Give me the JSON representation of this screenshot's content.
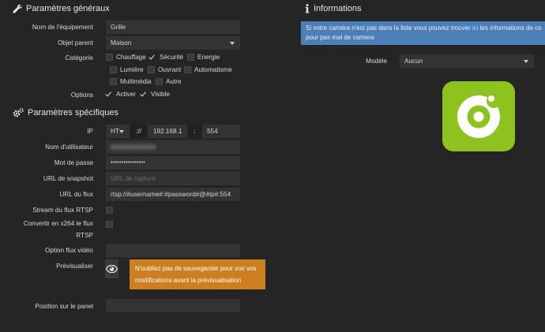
{
  "general": {
    "title": "Paramètres généraux",
    "name_label": "Nom de l'équipement",
    "name_value": "Grille",
    "parent_label": "Objet parent",
    "parent_value": "Maison",
    "category_label": "Catégorie",
    "categories": [
      {
        "label": "Chauffage",
        "checked": false
      },
      {
        "label": "Sécurité",
        "checked": true
      },
      {
        "label": "Energie",
        "checked": false
      },
      {
        "label": "Lumière",
        "checked": false
      },
      {
        "label": "Ouvrant",
        "checked": false
      },
      {
        "label": "Automatisme",
        "checked": false
      },
      {
        "label": "Multimédia",
        "checked": false
      },
      {
        "label": "Autre",
        "checked": false
      }
    ],
    "options_label": "Options",
    "options": [
      {
        "label": "Activer",
        "checked": true
      },
      {
        "label": "Visible",
        "checked": true
      }
    ]
  },
  "specific": {
    "title": "Paramètres spécifiques",
    "ip_label": "IP",
    "protocol": "HT",
    "scheme_sep": "://",
    "ip_value": "192.168.1",
    "port_sep": ":",
    "port_value": "554",
    "username_label": "Nom d'utilisateur",
    "username_value": "",
    "password_label": "Mot de passe",
    "password_value": "••••••••••••••••",
    "snapshot_label": "URL de snapshot",
    "snapshot_placeholder": "URL de capture",
    "stream_label": "URL du flux",
    "stream_value": "rtsp://#username#:#password#@#ip#:554",
    "rtsp_label": "Stream du flux RTSP",
    "x264_label_1": "Convertir en x264 le flux",
    "x264_label_2": "RTSP",
    "video_option_label": "Option flux vidéo",
    "video_option_value": "",
    "preview_label": "Prévisualiser",
    "preview_warning_1": "N'oubliez pas de sauvegarder pour voir vos",
    "preview_warning_2": "modifications avant la prévisualisation",
    "panel_position_label": "Position sur le panel",
    "panel_position_value": ""
  },
  "info": {
    "title": "Informations",
    "alert_part1": "Si votre caméra n'est pas dans la liste vous pouvez trouver",
    "alert_link": "ici",
    "alert_part2": "les informations de co",
    "alert_line2": "pour pas mal de camera",
    "model_label": "Modèle",
    "model_value": "Aucun"
  },
  "colors": {
    "background": "#252525",
    "input_bg": "#333333",
    "info_alert": "#4a7fb8",
    "warning": "#cd7f1f",
    "logo_green": "#8ec21f"
  },
  "icons": [
    "wrench-icon",
    "cogs-icon",
    "info-icon",
    "eye-icon",
    "camera-logo-icon"
  ]
}
